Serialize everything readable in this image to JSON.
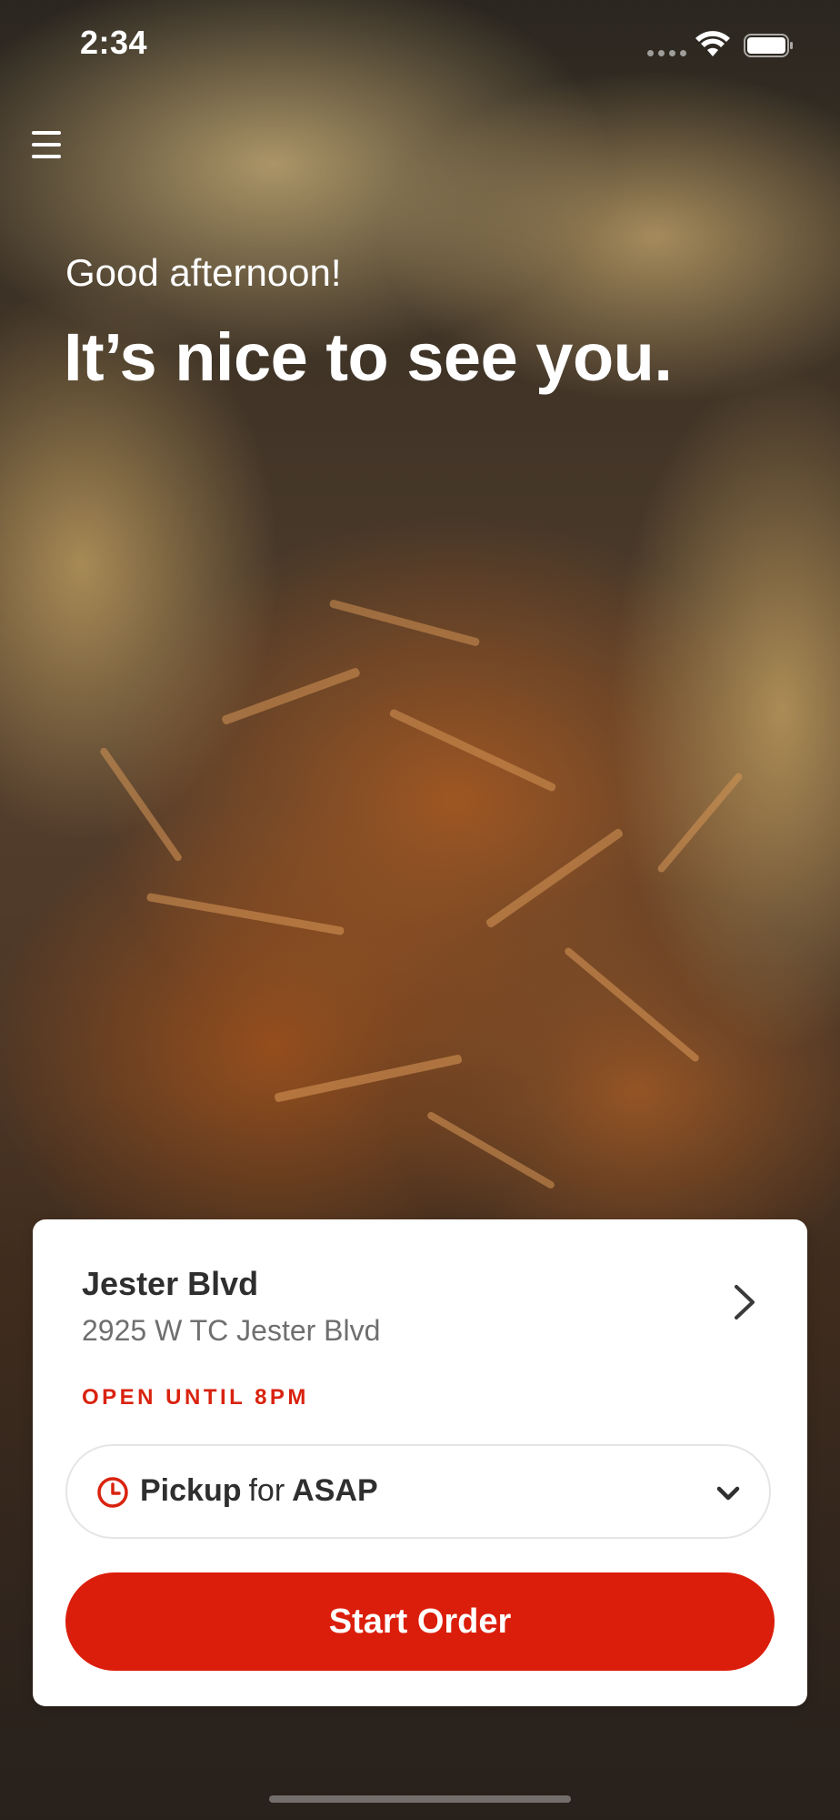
{
  "status_bar": {
    "time": "2:34"
  },
  "icons": {
    "menu": "hamburger-menu-icon",
    "wifi": "wifi-icon",
    "battery": "battery-icon",
    "chevron_right": "chevron-right-icon",
    "clock": "clock-icon",
    "chevron_down": "chevron-down-icon"
  },
  "hero": {
    "greeting": "Good afternoon!",
    "headline": "It’s nice to see you."
  },
  "location": {
    "name": "Jester Blvd",
    "address": "2925 W TC Jester Blvd",
    "status": "OPEN UNTIL 8PM"
  },
  "order_mode": {
    "mode": "Pickup",
    "connector": "for",
    "time": "ASAP"
  },
  "actions": {
    "start_order": "Start Order"
  },
  "colors": {
    "accent": "#db1e0b",
    "status_red": "#d9230f",
    "text_dark": "#2f2f2f",
    "text_muted": "#6f6f6f"
  }
}
